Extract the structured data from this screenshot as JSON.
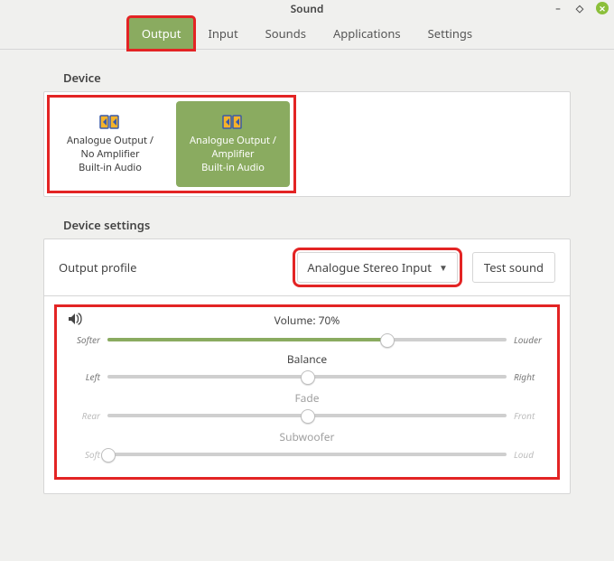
{
  "window": {
    "title": "Sound"
  },
  "tabs": {
    "output": "Output",
    "input": "Input",
    "sounds": "Sounds",
    "applications": "Applications",
    "settings": "Settings"
  },
  "sections": {
    "device": "Device",
    "settings": "Device settings"
  },
  "devices": [
    {
      "line1": "Analogue Output /",
      "line2": "No Amplifier",
      "line3": "Built-in Audio"
    },
    {
      "line1": "Analogue Output /",
      "line2": "Amplifier",
      "line3": "Built-in Audio"
    }
  ],
  "profile": {
    "label": "Output profile",
    "selected": "Analogue Stereo Input",
    "test_btn": "Test sound"
  },
  "sliders": {
    "volume": {
      "label": "Volume: 70%",
      "left": "Softer",
      "right": "Louder",
      "pct": 70,
      "fill": true
    },
    "balance": {
      "label": "Balance",
      "left": "Left",
      "right": "Right",
      "pct": 50,
      "fill": false
    },
    "fade": {
      "label": "Fade",
      "left": "Rear",
      "right": "Front",
      "pct": 50,
      "fill": false,
      "muted": true
    },
    "sub": {
      "label": "Subwoofer",
      "left": "Soft",
      "right": "Loud",
      "pct": 0,
      "fill": false,
      "muted": true
    }
  }
}
